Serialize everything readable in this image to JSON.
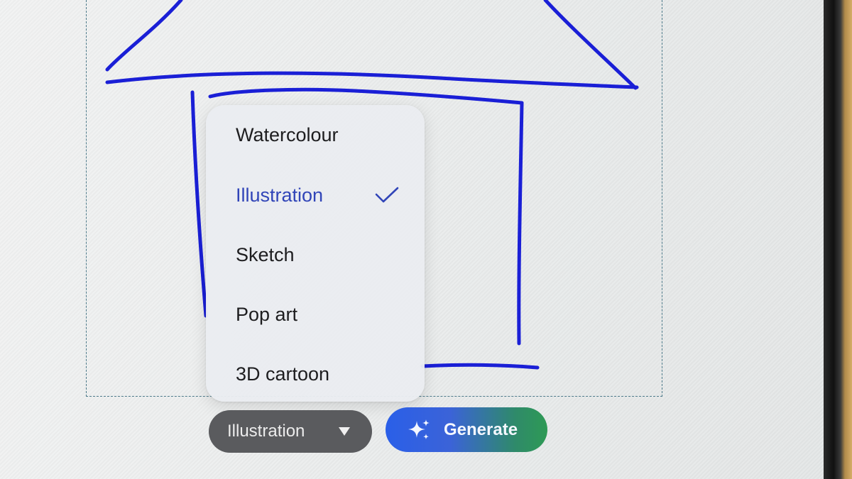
{
  "style_menu": {
    "items": [
      {
        "label": "Watercolour",
        "selected": false
      },
      {
        "label": "Illustration",
        "selected": true
      },
      {
        "label": "Sketch",
        "selected": false
      },
      {
        "label": "Pop art",
        "selected": false
      },
      {
        "label": "3D cartoon",
        "selected": false
      }
    ]
  },
  "toolbar": {
    "style_dropdown_value": "Illustration",
    "generate_label": "Generate"
  },
  "colors": {
    "ink": "#1a1fd6",
    "selected_text": "#3145b8",
    "dropdown_bg": "#5a5b5e",
    "generate_gradient_start": "#2a5fe8",
    "generate_gradient_end": "#2e9a55"
  },
  "icons": {
    "selected_marker": "check-icon",
    "dropdown": "dropdown-arrow-icon",
    "generate": "sparkle-icon"
  }
}
